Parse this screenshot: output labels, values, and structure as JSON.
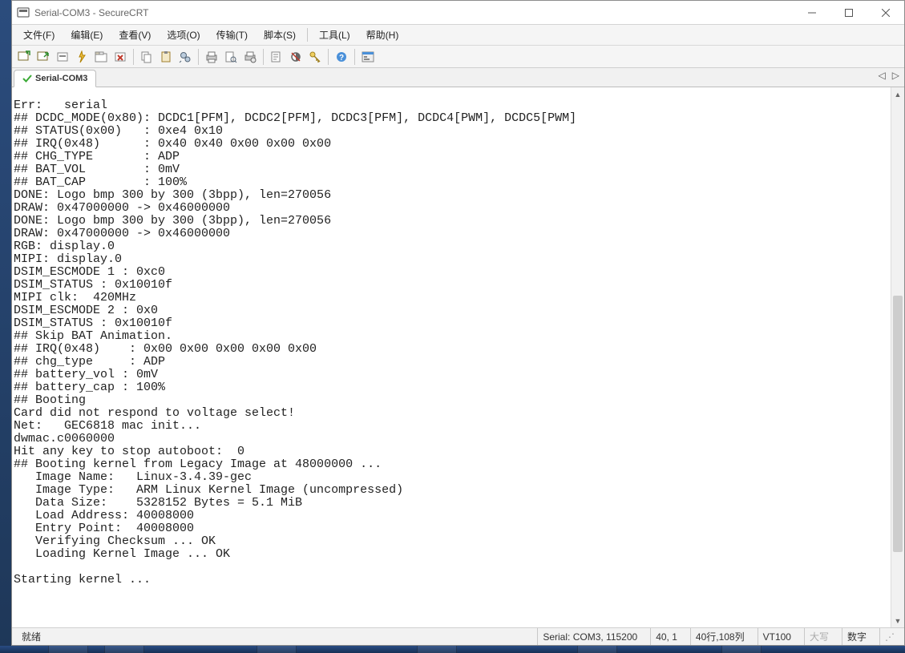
{
  "title": "Serial-COM3 - SecureCRT",
  "menus": [
    "文件(F)",
    "编辑(E)",
    "查看(V)",
    "选项(O)",
    "传输(T)",
    "脚本(S)",
    "工具(L)",
    "帮助(H)"
  ],
  "tab": {
    "label": "Serial-COM3"
  },
  "terminal_lines": [
    "Err:   serial",
    "## DCDC_MODE(0x80): DCDC1[PFM], DCDC2[PFM], DCDC3[PFM], DCDC4[PWM], DCDC5[PWM]",
    "## STATUS(0x00)   : 0xe4 0x10",
    "## IRQ(0x48)      : 0x40 0x40 0x00 0x00 0x00",
    "## CHG_TYPE       : ADP",
    "## BAT_VOL        : 0mV",
    "## BAT_CAP        : 100%",
    "DONE: Logo bmp 300 by 300 (3bpp), len=270056",
    "DRAW: 0x47000000 -> 0x46000000",
    "DONE: Logo bmp 300 by 300 (3bpp), len=270056",
    "DRAW: 0x47000000 -> 0x46000000",
    "RGB: display.0",
    "MIPI: display.0",
    "DSIM_ESCMODE 1 : 0xc0",
    "DSIM_STATUS : 0x10010f",
    "MIPI clk:  420MHz",
    "DSIM_ESCMODE 2 : 0x0",
    "DSIM_STATUS : 0x10010f",
    "## Skip BAT Animation.",
    "## IRQ(0x48)    : 0x00 0x00 0x00 0x00 0x00",
    "## chg_type     : ADP",
    "## battery_vol : 0mV",
    "## battery_cap : 100%",
    "## Booting",
    "Card did not respond to voltage select!",
    "Net:   GEC6818 mac init...",
    "dwmac.c0060000",
    "Hit any key to stop autoboot:  0",
    "## Booting kernel from Legacy Image at 48000000 ...",
    "   Image Name:   Linux-3.4.39-gec",
    "   Image Type:   ARM Linux Kernel Image (uncompressed)",
    "   Data Size:    5328152 Bytes = 5.1 MiB",
    "   Load Address: 40008000",
    "   Entry Point:  40008000",
    "   Verifying Checksum ... OK",
    "   Loading Kernel Image ... OK",
    "",
    "Starting kernel ...",
    ""
  ],
  "status": {
    "ready": "就绪",
    "conn": "Serial: COM3, 115200",
    "cursor": "40,  1",
    "dims": "40行,108列",
    "emul": "VT100",
    "caps": "大写",
    "num": "数字"
  },
  "toolbar_icons": [
    "new-session-icon",
    "reconnect-icon",
    "disconnect-icon",
    "quick-connect-icon",
    "tabbed-icon",
    "close-session-icon",
    "|",
    "copy-icon",
    "paste-icon",
    "find-icon",
    "|",
    "print-icon",
    "print-preview-icon",
    "printer-setup-icon",
    "|",
    "log-session-icon",
    "toggle-icon",
    "key-icon",
    "|",
    "help-icon",
    "|",
    "session-manager-icon"
  ]
}
